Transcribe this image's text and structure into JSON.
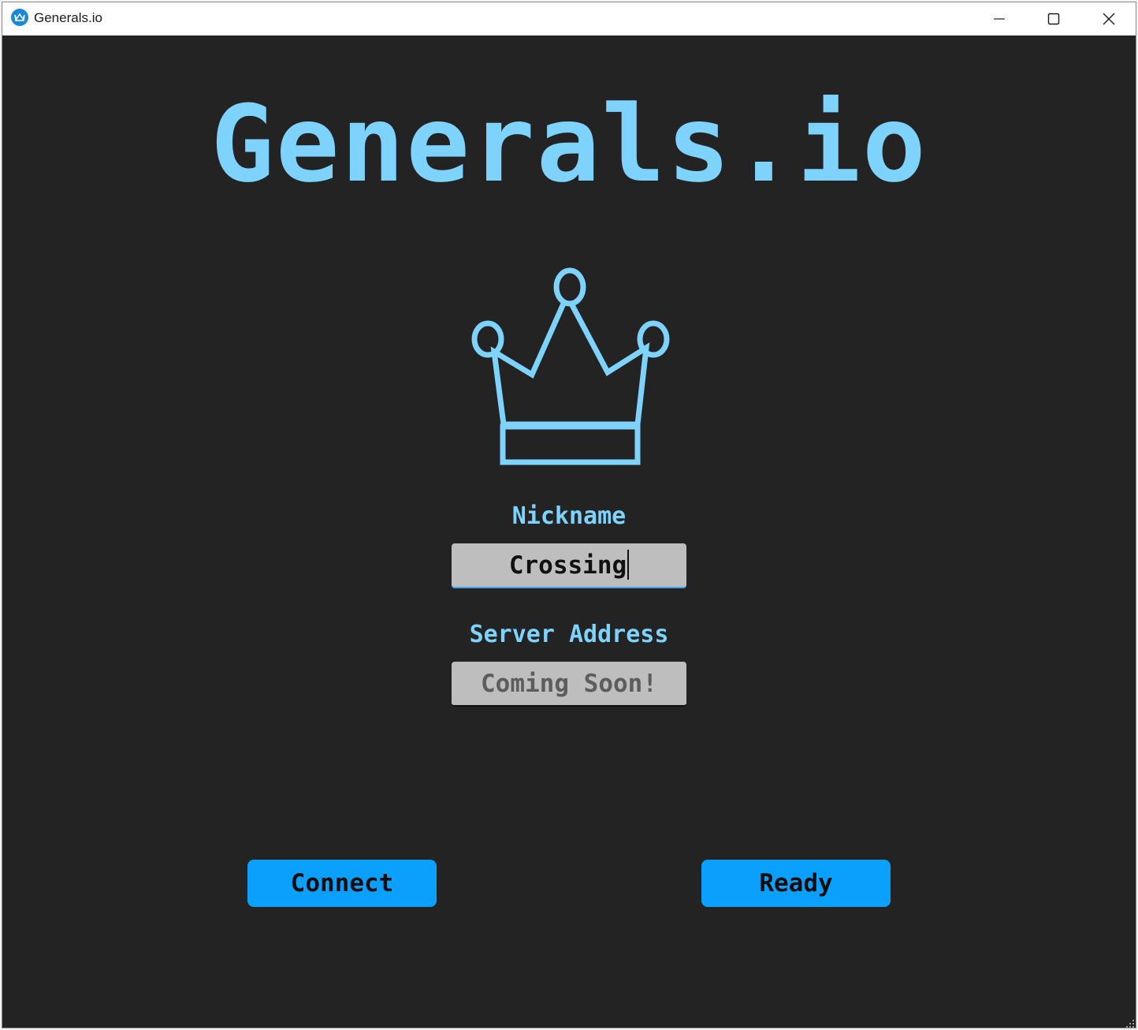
{
  "window": {
    "title": "Generals.io",
    "app_icon": "crown-app-icon",
    "controls": [
      "minimize-icon",
      "maximize-icon",
      "close-icon"
    ]
  },
  "main": {
    "title": "Generals.io",
    "logo_icon": "crown-icon",
    "nickname": {
      "label": "Nickname",
      "value": "Crossing"
    },
    "server_address": {
      "label": "Server Address",
      "placeholder": "Coming Soon!"
    },
    "buttons": {
      "connect": "Connect",
      "ready": "Ready"
    }
  },
  "colors": {
    "background": "#232323",
    "accent": "#7dd3fc",
    "button": "#0aa0fc",
    "field": "#bebebe"
  }
}
